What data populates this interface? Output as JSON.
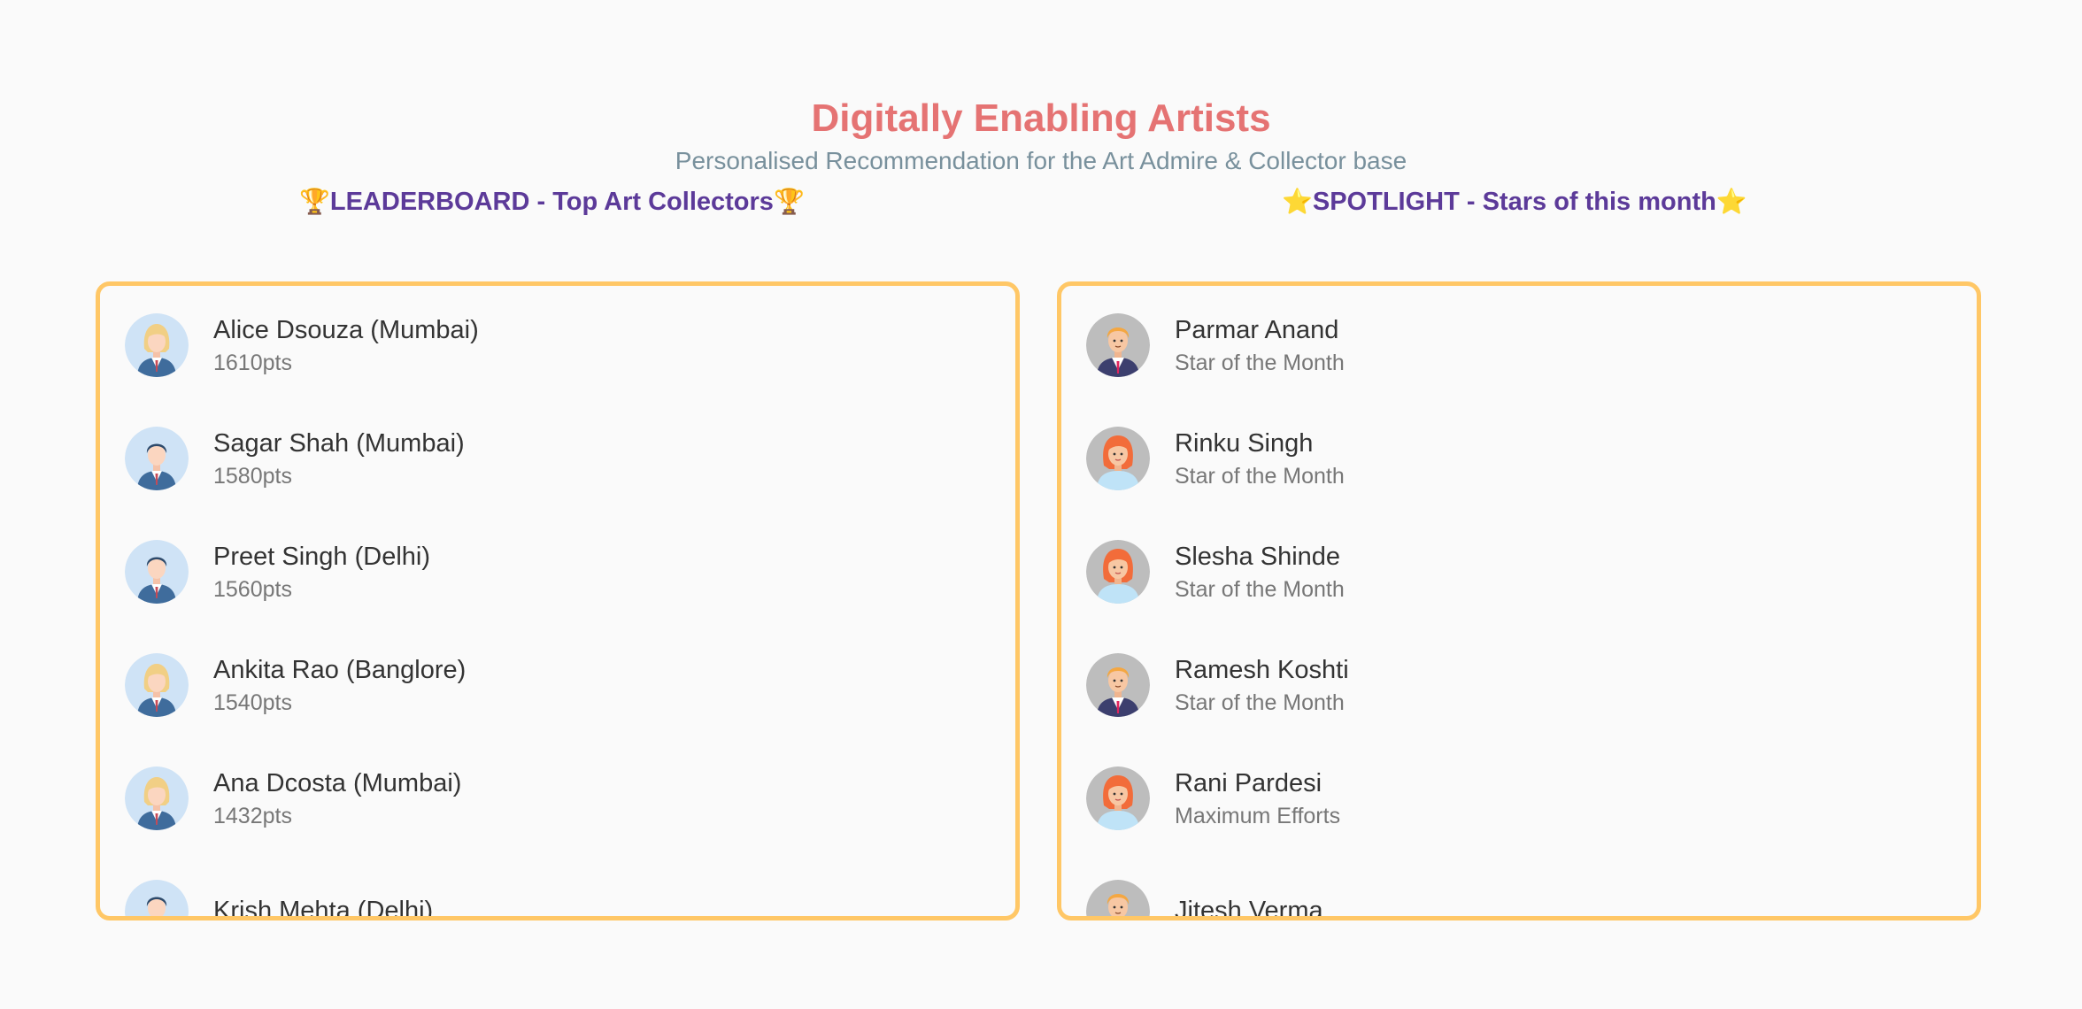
{
  "header": {
    "title": "Digitally Enabling Artists",
    "subtitle": "Personalised Recommendation for the Art Admire & Collector base",
    "title_color": "#e57373",
    "subtitle_color": "#78909c"
  },
  "leaderboard": {
    "heading": "LEADERBOARD - Top Art Collectors",
    "icon": "trophy-icon",
    "accent": "#5c3a99",
    "border_color": "#ffc766",
    "entries": [
      {
        "name": "Alice Dsouza (Mumbai)",
        "points": "1610pts",
        "avatar": "female-avatar-icon"
      },
      {
        "name": "Sagar Shah (Mumbai)",
        "points": "1580pts",
        "avatar": "male-avatar-icon"
      },
      {
        "name": "Preet Singh (Delhi)",
        "points": "1560pts",
        "avatar": "male-avatar-icon"
      },
      {
        "name": "Ankita Rao (Banglore)",
        "points": "1540pts",
        "avatar": "female-avatar-icon"
      },
      {
        "name": "Ana Dcosta (Mumbai)",
        "points": "1432pts",
        "avatar": "female-avatar-icon"
      },
      {
        "name": "Krish Mehta (Delhi)",
        "points": "",
        "avatar": "male-avatar-icon"
      }
    ]
  },
  "spotlight": {
    "heading": "SPOTLIGHT - Stars of this month",
    "icon": "star-icon",
    "accent": "#5c3a99",
    "border_color": "#ffc766",
    "entries": [
      {
        "name": "Parmar Anand",
        "note": "Star of the Month",
        "avatar": "man-avatar-icon"
      },
      {
        "name": "Rinku Singh",
        "note": "Star of the Month",
        "avatar": "woman-avatar-icon"
      },
      {
        "name": "Slesha Shinde",
        "note": "Star of the Month",
        "avatar": "woman-avatar-icon"
      },
      {
        "name": "Ramesh Koshti",
        "note": "Star of the Month",
        "avatar": "man-avatar-icon"
      },
      {
        "name": "Rani Pardesi",
        "note": "Maximum Efforts",
        "avatar": "woman-avatar-icon"
      },
      {
        "name": "Jitesh Verma",
        "note": "",
        "avatar": "man-avatar-icon"
      }
    ]
  }
}
